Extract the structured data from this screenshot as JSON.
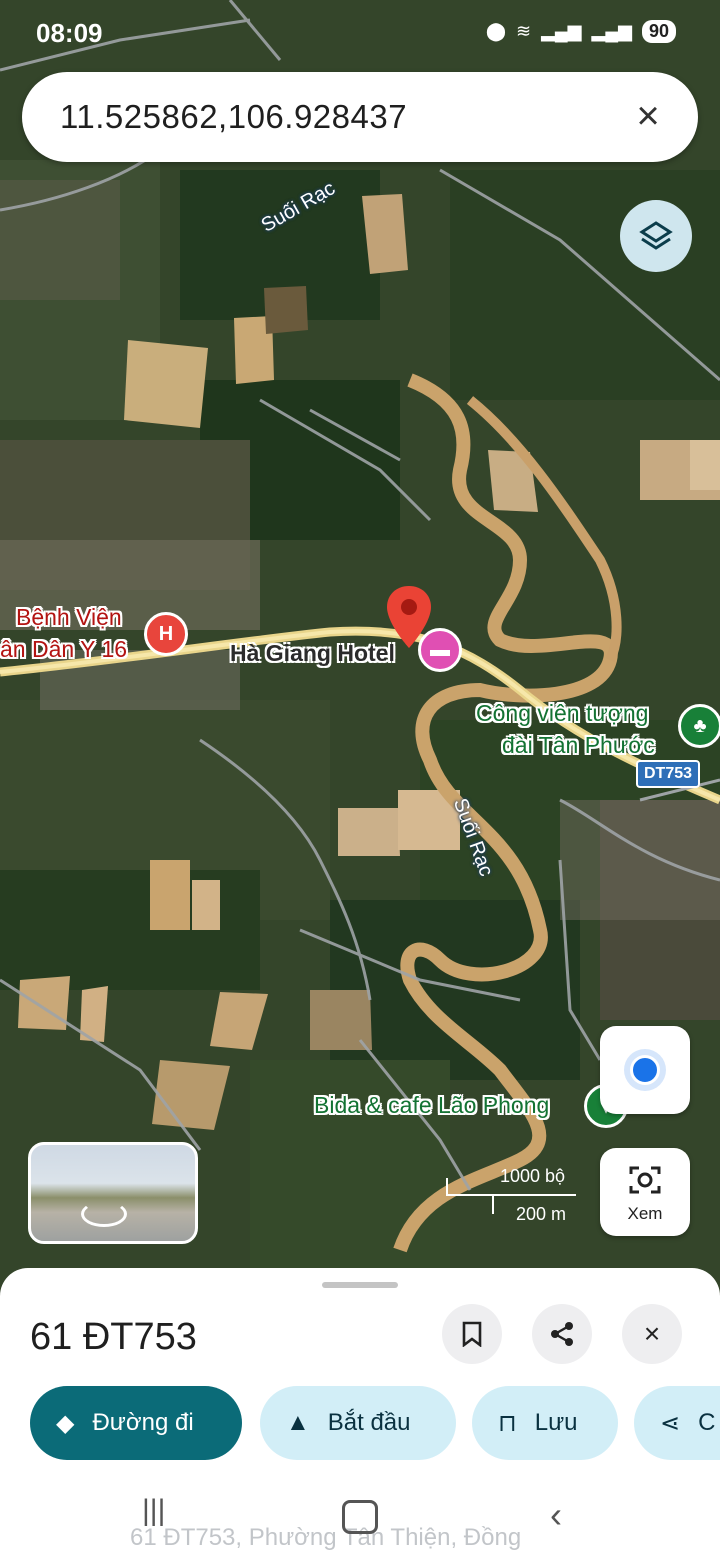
{
  "status_bar": {
    "time": "08:09",
    "battery": "90"
  },
  "search": {
    "query": "11.525862,106.928437"
  },
  "map": {
    "labels": {
      "suoi_rac_top": "Suối Rạc",
      "suoi_rac_mid": "Suối Rạc",
      "hospital_line1": "Bệnh Viện",
      "hospital_line2": "ân Dân Y 16",
      "hotel": "Hà Giang Hotel",
      "park_line1": "Công viên tượng",
      "park_line2": "đài Tân Phước",
      "road": "DT753",
      "cafe": "Bida & cafe Lão Phong"
    },
    "scale": {
      "imperial": "1000 bộ",
      "metric": "200 m"
    },
    "view_button": "Xem"
  },
  "sheet": {
    "place_name": "61 ĐT753",
    "chips": {
      "directions": "Đường đi",
      "start": "Bắt đầu",
      "save": "Lưu",
      "share": "C"
    },
    "address_preview": "61 ĐT753, Phường Tân Thiện, Đồng"
  },
  "colors": {
    "accent": "#0b6b78",
    "chip_bg": "#d2eef7",
    "pin": "#ea4335",
    "hotel_pin": "#e04fb3",
    "hospital_pin": "#e8453c",
    "park_pin": "#188038"
  }
}
